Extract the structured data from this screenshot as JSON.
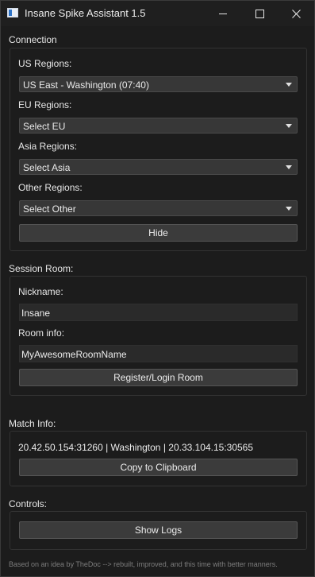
{
  "window": {
    "title": "Insane Spike Assistant 1.5"
  },
  "connection": {
    "header": "Connection",
    "us_label": "US Regions:",
    "us_value": "US East - Washington (07:40)",
    "eu_label": "EU Regions:",
    "eu_value": "Select EU",
    "asia_label": "Asia Regions:",
    "asia_value": "Select Asia",
    "other_label": "Other Regions:",
    "other_value": "Select Other",
    "hide_label": "Hide"
  },
  "session": {
    "header": "Session Room:",
    "nickname_label": "Nickname:",
    "nickname_value": "Insane",
    "room_label": "Room info:",
    "room_value": "MyAwesomeRoomName",
    "register_label": "Register/Login Room"
  },
  "match": {
    "header": "Match Info:",
    "info_text": "20.42.50.154:31260 | Washington | 20.33.104.15:30565",
    "copy_label": "Copy to Clipboard"
  },
  "controls": {
    "header": "Controls:",
    "show_logs_label": "Show Logs"
  },
  "footer": {
    "text": "Based on an idea by TheDoc --> rebuilt, improved, and this time with better manners."
  },
  "icons": {
    "app": "app-window-icon",
    "minimize": "minimize-icon",
    "maximize": "maximize-icon",
    "close": "close-icon",
    "dropdown": "chevron-down-icon"
  },
  "colors": {
    "background": "#1c1c1c",
    "control": "#373737",
    "button": "#3b3b3b",
    "text": "#e6e6e6",
    "footer_text": "#7d7d7d"
  }
}
